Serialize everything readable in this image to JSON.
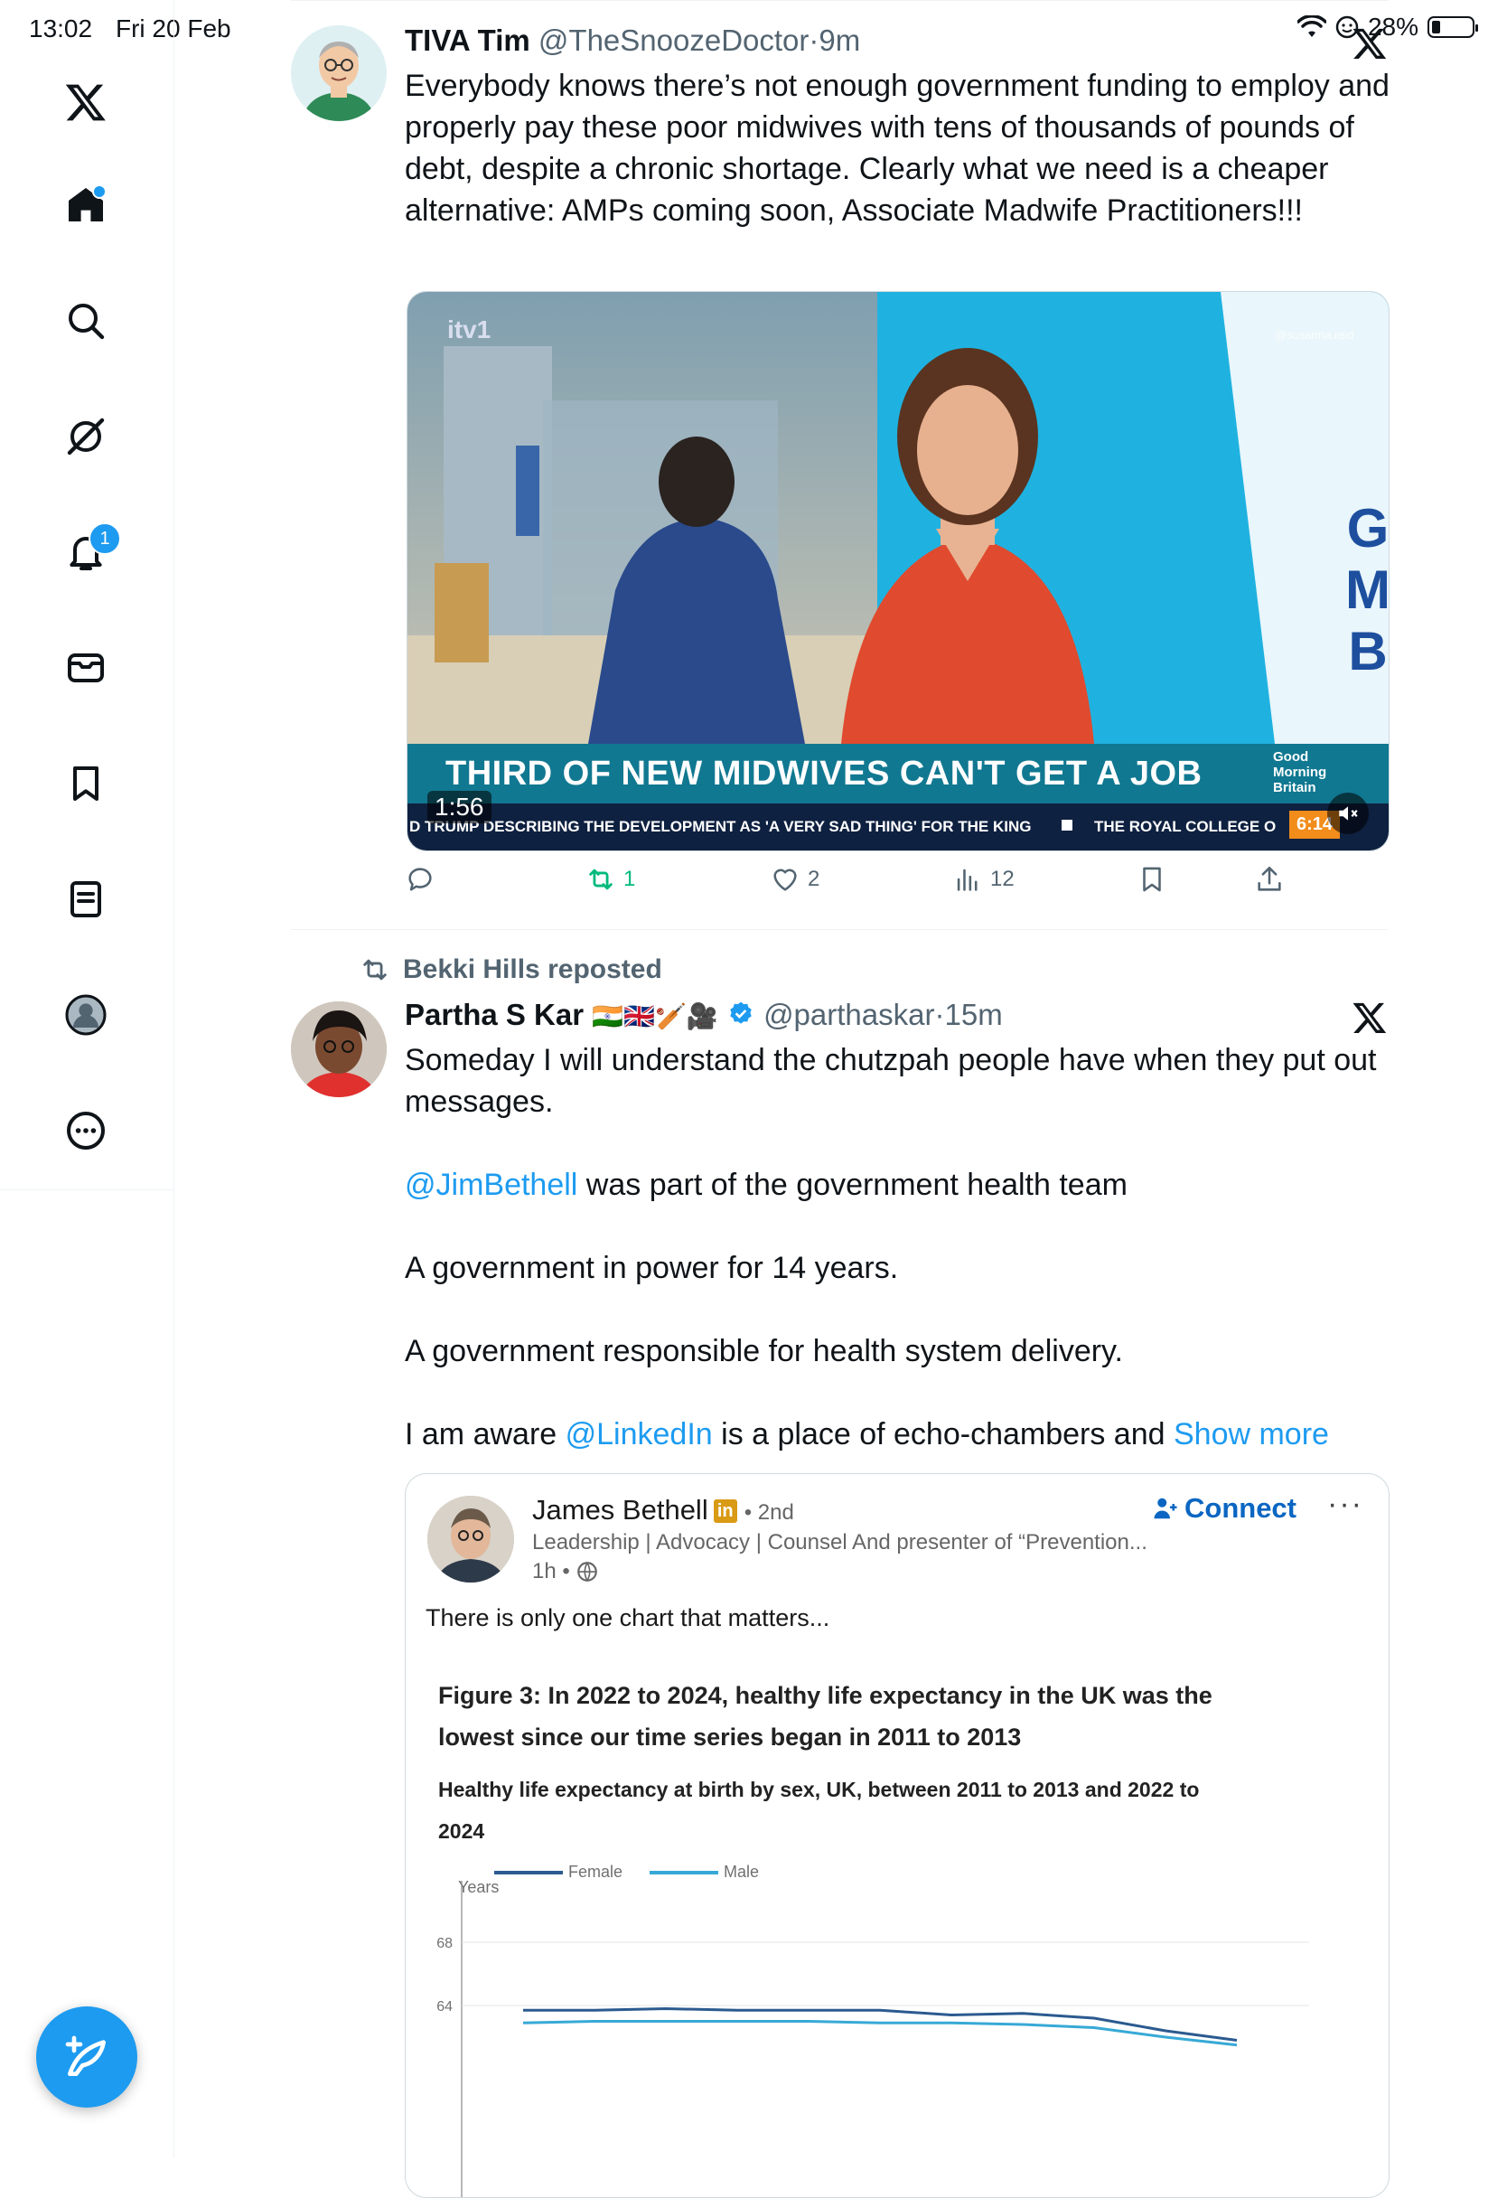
{
  "status_bar": {
    "time": "13:02",
    "date": "Fri 20 Feb",
    "battery": "28%"
  },
  "sidebar": {
    "items": [
      {
        "name": "x-logo"
      },
      {
        "name": "home"
      },
      {
        "name": "explore"
      },
      {
        "name": "grok"
      },
      {
        "name": "notifications",
        "badge": "1"
      },
      {
        "name": "messages"
      },
      {
        "name": "bookmarks"
      },
      {
        "name": "lists"
      },
      {
        "name": "profile"
      },
      {
        "name": "more"
      }
    ]
  },
  "tweet1": {
    "author_name": "TIVA Tim",
    "handle": "@TheSnoozeDoctor",
    "sep": "·",
    "time": "9m",
    "text": "Everybody knows there’s not enough government funding to employ and properly pay these poor midwives with tens of thousands of pounds of debt, despite a chronic shortage. Clearly what we need is a cheaper alternative: AMPs coming soon, Associate Madwife Practitioners!!!",
    "video": {
      "headline": "THIRD OF NEW MIDWIVES CAN'T GET A JOB",
      "ticker": "D TRUMP DESCRIBING THE DEVELOPMENT AS 'A VERY SAD THING' FOR THE KING",
      "ticker2": "THE ROYAL COLLEGE O",
      "clock": "6:14",
      "duration": "1:56",
      "brand_line1": "Good",
      "brand_line2": "Morning",
      "brand_line3": "Britain",
      "channel": "itv1",
      "watermark": "@susanna.reid",
      "side_letters": [
        "G",
        "M",
        "B"
      ]
    },
    "actions": {
      "replies": "",
      "reposts": "1",
      "likes": "2",
      "views": "12"
    },
    "colors": {
      "repost_active": "#00ba7c"
    }
  },
  "tweet2": {
    "repost_label": "Bekki Hills reposted",
    "author_name": "Partha S Kar",
    "emojis": "🇮🇳🇬🇧🏏🎥",
    "handle": "@parthaskar",
    "sep": "·",
    "time": "15m",
    "p1": "Someday I will understand the chutzpah people have when they put out messages.",
    "mention1": "@JimBethell",
    "p2_rest": " was part of the government health team",
    "p3": "A government in power for 14 years.",
    "p4": "A government responsible for health system delivery.",
    "p5_start": "I am aware ",
    "mention2": "@LinkedIn",
    "p5_rest": " is a place of echo-chambers and ",
    "show_more": "Show more"
  },
  "linkedin_card": {
    "name": "James Bethell",
    "badge": "in",
    "degree": "• 2nd",
    "headline": "Leadership | Advocacy | Counsel And presenter of “Prevention...",
    "time": "1h •",
    "connect": "Connect",
    "more": "···",
    "body": "There is only one chart that matters..."
  },
  "chart_data": {
    "type": "line",
    "title": "Figure 3: In 2022 to 2024, healthy life expectancy in the UK was the lowest since our time series began in 2011 to 2013",
    "subtitle": "Healthy life expectancy at birth by sex, UK, between 2011 to 2013 and 2022 to 2024",
    "ylabel": "Years",
    "y_ticks": [
      "68",
      "64"
    ],
    "ylim": [
      62,
      70
    ],
    "series": [
      {
        "name": "Female",
        "color": "#2b5a8f",
        "values": [
          63.7,
          63.7,
          63.8,
          63.7,
          63.7,
          63.7,
          63.4,
          63.5,
          63.2,
          62.4,
          61.8
        ]
      },
      {
        "name": "Male",
        "color": "#37a9d6",
        "values": [
          62.9,
          63.0,
          63.0,
          63.0,
          63.0,
          62.9,
          62.9,
          62.8,
          62.6,
          62.0,
          61.5
        ]
      }
    ]
  },
  "colors": {
    "accent": "#1d9bf0",
    "text": "#0f1419",
    "muted": "#536471"
  }
}
